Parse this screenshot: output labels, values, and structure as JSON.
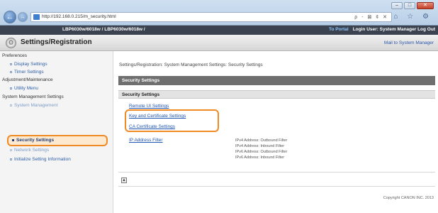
{
  "browser": {
    "url": "http://192.168.0.215/m_security.html",
    "search_tools": "ρ - ⊠ ¢ ✕",
    "toolbar_icons": "⌂ ☆ ⚙",
    "window_buttons": [
      "–",
      "□",
      "✕"
    ]
  },
  "header": {
    "device": "LBP6030w/6018w / LBP6030w/6018w /",
    "portal": "To Portal",
    "login": "Login User: System Manager Log Out"
  },
  "titlebar": {
    "title": "Settings/Registration",
    "mail": "Mail to System Manager"
  },
  "sidebar": {
    "items": [
      {
        "label": "Preferences",
        "type": "head"
      },
      {
        "label": "Display Settings",
        "type": "sub"
      },
      {
        "label": "Timer Settings",
        "type": "sub"
      },
      {
        "label": "Adjustment/Maintenance",
        "type": "head"
      },
      {
        "label": "Utility Menu",
        "type": "sub"
      },
      {
        "label": "System Management Settings",
        "type": "head"
      },
      {
        "label": "System Management",
        "type": "sub"
      },
      {
        "label": "Security Settings",
        "type": "active"
      },
      {
        "label": "Network Settings",
        "type": "sub"
      },
      {
        "label": "Initialize Setting Information",
        "type": "sub"
      }
    ]
  },
  "main": {
    "breadcrumb": "Settings/Registration: System Management Settings: Security Settings",
    "section_title": "Security Settings",
    "sub_title": "Security Settings",
    "links": {
      "remote_ui": "Remote UI Settings",
      "key_cert": "Key and Certificate Settings",
      "ca_cert": "CA Certificate Settings",
      "ip_filter": "IP Address Filter"
    },
    "filters": [
      "IPv4 Address: Outbound Filter",
      "IPv4 Address: Inbound Filter",
      "IPv6 Address: Outbound Filter",
      "IPv6 Address: Inbound Filter"
    ],
    "top_icon": "▲",
    "copyright": "Copyright CANON INC. 2013"
  },
  "colors": {
    "highlight": "#f08a24",
    "link": "#1f55b1",
    "header_bg": "#3c4350",
    "section_bg": "#6f6f6f"
  }
}
